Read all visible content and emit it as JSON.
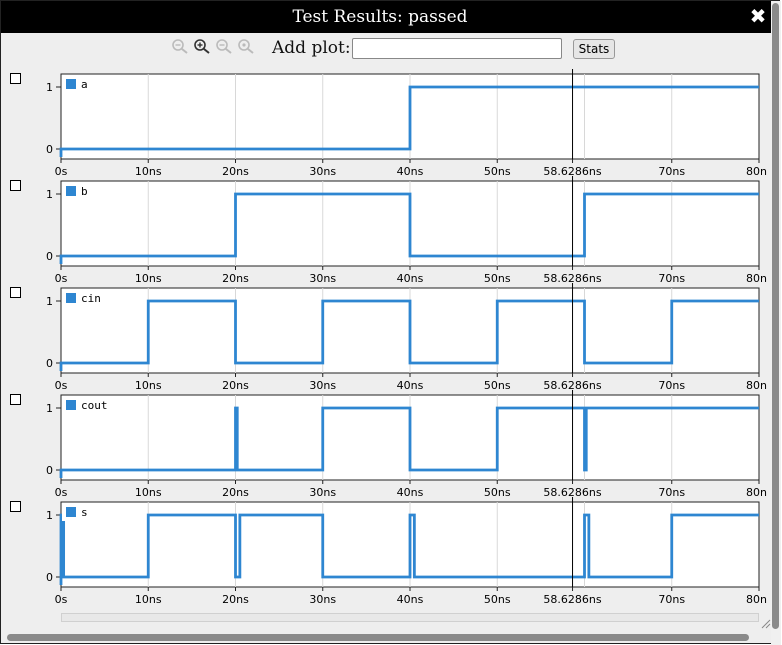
{
  "window": {
    "title": "Test Results: passed",
    "close_glyph": "✖"
  },
  "toolbar": {
    "icons": [
      "zoom-out-icon",
      "zoom-in-icon",
      "zoom-out-icon",
      "zoom-reset-icon"
    ],
    "add_plot_label": "Add plot:",
    "add_plot_value": "",
    "stats_label": "Stats"
  },
  "colors": {
    "trace": "#2e86d1",
    "cursor": "#000000",
    "grid": "#d8d8d8",
    "plot_bg": "#ffffff",
    "window_bg": "#eeeeee"
  },
  "cursor_time_label": "58.6286ns",
  "chart_data": [
    {
      "type": "line",
      "series": [
        {
          "name": "a",
          "x": [
            0,
            40,
            80
          ],
          "y": [
            0,
            1,
            1
          ]
        }
      ],
      "x_range": [
        0,
        80
      ],
      "y_range": [
        0,
        1
      ],
      "x_ticks": [
        "0s",
        "10ns",
        "20ns",
        "30ns",
        "40ns",
        "50ns",
        "58.6286ns",
        "70ns",
        "80n"
      ],
      "y_ticks": [
        "0",
        "1"
      ],
      "grid": true,
      "legend": "top-left"
    },
    {
      "type": "line",
      "series": [
        {
          "name": "b",
          "x": [
            0,
            20,
            40,
            60,
            80
          ],
          "y": [
            0,
            1,
            0,
            1,
            1
          ]
        }
      ],
      "x_range": [
        0,
        80
      ],
      "y_range": [
        0,
        1
      ],
      "x_ticks": [
        "0s",
        "10ns",
        "20ns",
        "30ns",
        "40ns",
        "50ns",
        "58.6286ns",
        "70ns",
        "80n"
      ],
      "y_ticks": [
        "0",
        "1"
      ],
      "grid": true,
      "legend": "top-left"
    },
    {
      "type": "line",
      "series": [
        {
          "name": "cin",
          "x": [
            0,
            10,
            20,
            30,
            40,
            50,
            60,
            70,
            80
          ],
          "y": [
            0,
            1,
            0,
            1,
            0,
            1,
            0,
            1,
            1
          ]
        }
      ],
      "x_range": [
        0,
        80
      ],
      "y_range": [
        0,
        1
      ],
      "x_ticks": [
        "0s",
        "10ns",
        "20ns",
        "30ns",
        "40ns",
        "50ns",
        "58.6286ns",
        "70ns",
        "80n"
      ],
      "y_ticks": [
        "0",
        "1"
      ],
      "grid": true,
      "legend": "top-left"
    },
    {
      "type": "line",
      "series": [
        {
          "name": "cout",
          "x": [
            0,
            20,
            20.2,
            30,
            40,
            50,
            60,
            60.2,
            80
          ],
          "y": [
            0,
            1,
            0,
            1,
            0,
            1,
            0,
            1,
            1
          ]
        }
      ],
      "x_range": [
        0,
        80
      ],
      "y_range": [
        0,
        1
      ],
      "x_ticks": [
        "0s",
        "10ns",
        "20ns",
        "30ns",
        "40ns",
        "50ns",
        "58.6286ns",
        "70ns",
        "80n"
      ],
      "y_ticks": [
        "0",
        "1"
      ],
      "grid": true,
      "legend": "top-left"
    },
    {
      "type": "line",
      "series": [
        {
          "name": "s",
          "x": [
            0,
            0.3,
            10,
            20,
            20.5,
            30,
            40,
            40.5,
            50,
            60,
            60.5,
            70,
            80
          ],
          "y": [
            1,
            0,
            1,
            0,
            1,
            0,
            1,
            0,
            0,
            1,
            0,
            1,
            1
          ]
        }
      ],
      "x_range": [
        0,
        80
      ],
      "y_range": [
        0,
        1
      ],
      "x_ticks": [
        "0s",
        "10ns",
        "20ns",
        "30ns",
        "40ns",
        "50ns",
        "58.6286ns",
        "70ns",
        "80n"
      ],
      "y_ticks": [
        "0",
        "1"
      ],
      "grid": true,
      "legend": "top-left"
    }
  ]
}
